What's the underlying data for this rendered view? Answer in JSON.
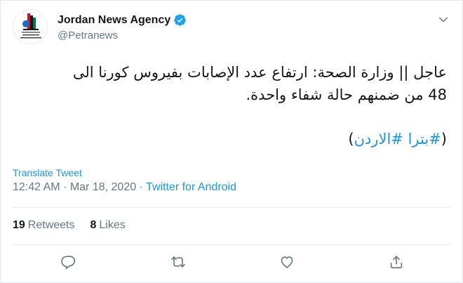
{
  "author": {
    "name": "Jordan News Agency",
    "handle": "@Petranews",
    "verified": true,
    "avatar_caption_ar": "وكالة الأنباء الأردنية",
    "avatar_caption_en": "Jordan News Agency"
  },
  "tweet": {
    "line1": "عاجل || وزارة الصحة: ارتفاع عدد الإصابات بفيروس كورنا الى",
    "line2": "48 من ضمنهم حالة شفاء واحدة.",
    "tag_open": "(",
    "tag1": "#بترا",
    "tag2": "#الاردن",
    "tag_close": ")"
  },
  "translate_label": "Translate Tweet",
  "meta": {
    "time": "12:42 AM",
    "separator1": " · ",
    "date": "Mar 18, 2020",
    "separator2": " · ",
    "source": "Twitter for Android"
  },
  "stats": {
    "retweets_count": "19",
    "retweets_label": "Retweets",
    "likes_count": "8",
    "likes_label": "Likes"
  },
  "icons": [
    "caret-down-icon",
    "verified-badge-icon",
    "reply-icon",
    "retweet-icon",
    "like-icon",
    "share-icon"
  ],
  "colors": {
    "accent": "#1b95e0",
    "verified": "#1da1f2",
    "muted": "#657786",
    "text": "#14171a",
    "divider": "#e6ecf0"
  }
}
